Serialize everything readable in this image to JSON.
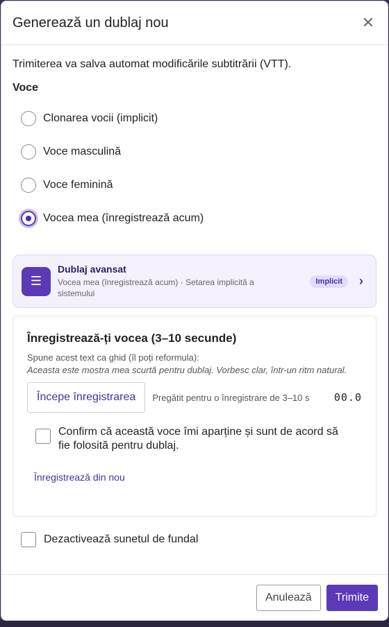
{
  "dialog": {
    "title": "Generează un dublaj nou",
    "close_icon": "close-icon",
    "info_text": "Trimiterea va salva automat modificările subtitrării (VTT).",
    "voice_heading": "Voce"
  },
  "voice_options": [
    {
      "label": "Clonarea vocii (implicit)",
      "selected": false
    },
    {
      "label": "Voce masculină",
      "selected": false
    },
    {
      "label": "Voce feminină",
      "selected": false
    },
    {
      "label": "Vocea mea (înregistrează acum)",
      "selected": true
    }
  ],
  "advanced": {
    "icon": "list-icon",
    "title": "Dublaj avansat",
    "subtitle": "Vocea mea (înregistrează acum) · Setarea implicită a sistemului",
    "badge": "Implicit",
    "chevron": "chevron-right-icon"
  },
  "recording": {
    "title": "Înregistrează-ți vocea (3–10 secunde)",
    "guide_label": "Spune acest text ca ghid (îl poți reformula):",
    "guide_text": "Aceasta este mostra mea scurtă pentru dublaj. Vorbesc clar, într-un ritm natural.",
    "start_button": "Începe înregistrarea",
    "status": "Pregătit pentru o înregistrare de 3–10 s",
    "timer": "00.0",
    "confirm_label": "Confirm că această voce îmi aparține și sunt de acord să fie folosită pentru dublaj.",
    "rerecord_link": "Înregistrează din nou"
  },
  "background_audio": {
    "label": "Dezactivează sunetul de fundal",
    "checked": false
  },
  "footer": {
    "cancel": "Anulează",
    "submit": "Trimite"
  },
  "colors": {
    "accent": "#5b3ab8",
    "accent_light": "#f4f1fd"
  }
}
